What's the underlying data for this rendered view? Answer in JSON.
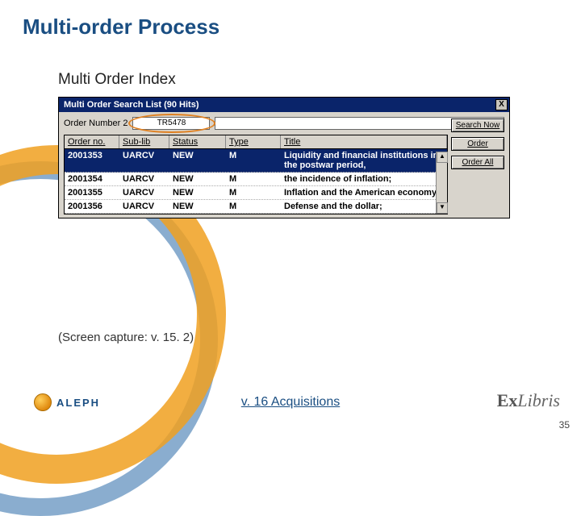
{
  "slide": {
    "title": "Multi-order Process",
    "subtitle": "Multi Order Index",
    "caption": "(Screen capture: v. 15. 2)",
    "footer_center": "v. 16 Acquisitions",
    "footer_left": "ALEPH",
    "footer_right_prefix": "Ex",
    "footer_right_suffix": "Libris",
    "number": "35"
  },
  "window": {
    "title": "Multi Order Search List (90 Hits)",
    "close": "X",
    "search_label": "Order Number 2",
    "search_value": "TR5478",
    "buttons": {
      "search_now": "Search Now",
      "order": "Order",
      "order_all": "Order All"
    },
    "columns": {
      "order_no": "Order no.",
      "sub_lib": "Sub-lib",
      "status": "Status",
      "type": "Type",
      "title": "Title"
    },
    "rows": [
      {
        "order_no": "2001353",
        "sub_lib": "UARCV",
        "status": "NEW",
        "type": "M",
        "title": "Liquidity and financial institutions in the postwar period,",
        "selected": true
      },
      {
        "order_no": "2001354",
        "sub_lib": "UARCV",
        "status": "NEW",
        "type": "M",
        "title": "the incidence of inflation;"
      },
      {
        "order_no": "2001355",
        "sub_lib": "UARCV",
        "status": "NEW",
        "type": "M",
        "title": "Inflation and the American economy,"
      },
      {
        "order_no": "2001356",
        "sub_lib": "UARCV",
        "status": "NEW",
        "type": "M",
        "title": "Defense and the dollar;"
      }
    ],
    "scroll_up": "▲",
    "scroll_down": "▼"
  }
}
